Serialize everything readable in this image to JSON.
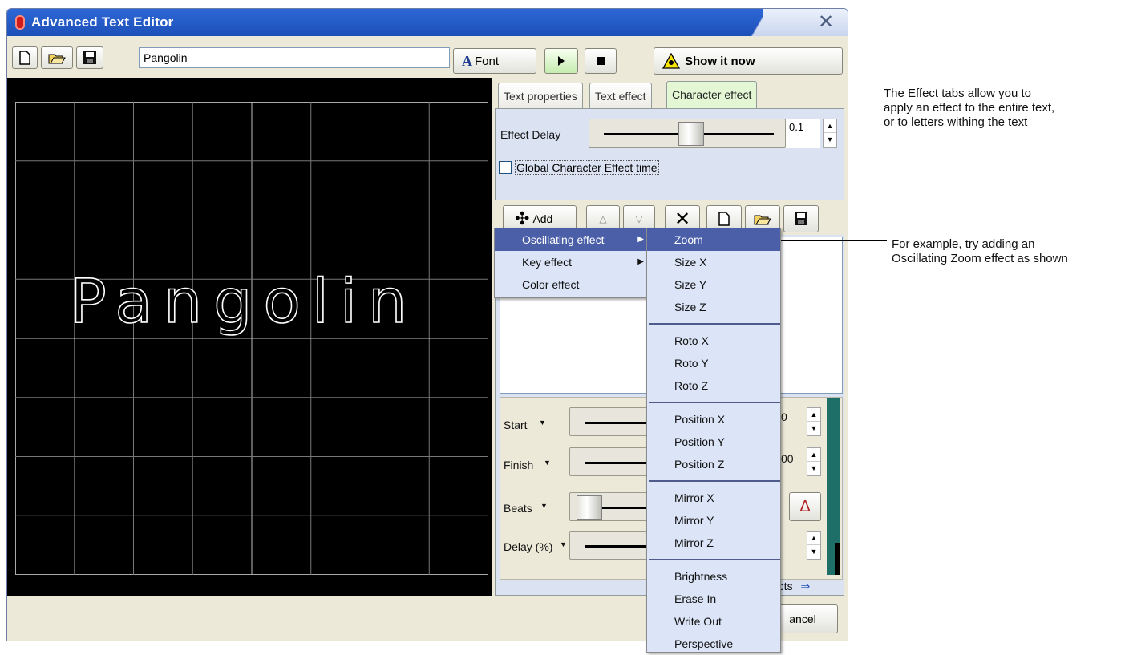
{
  "window": {
    "title": "Advanced Text Editor",
    "close_glyph": "✕"
  },
  "toolbar": {
    "text_value": "Pangolin",
    "font_label": "Font",
    "font_icon_letter": "A",
    "show_label": "Show it now"
  },
  "preview": {
    "text": "Pangolin"
  },
  "tabs": [
    {
      "label": "Text properties"
    },
    {
      "label": "Text effect"
    },
    {
      "label": "Character effect"
    }
  ],
  "char_effect": {
    "effect_delay_label": "Effect Delay",
    "effect_delay_value": "0.1",
    "global_checkbox_label": "Global Character Effect time",
    "global_checked": false,
    "add_label": "Add",
    "effect_delay_slider_fraction": 0.5
  },
  "params": [
    {
      "label": "Start",
      "value": "0"
    },
    {
      "label": "Finish",
      "value": "00"
    },
    {
      "label": "Beats",
      "value": ""
    },
    {
      "label": "Delay (%)",
      "value": ""
    }
  ],
  "effects_link": "fects",
  "cancel_label": "ancel",
  "menu_main": [
    {
      "label": "Oscillating effect",
      "submenu": true,
      "highlighted": true
    },
    {
      "label": "Key effect",
      "submenu": true,
      "highlighted": false
    },
    {
      "label": "Color effect",
      "submenu": false,
      "highlighted": false
    }
  ],
  "menu_sub": [
    {
      "label": "Zoom",
      "highlighted": true
    },
    {
      "label": "Size X"
    },
    {
      "label": "Size Y"
    },
    {
      "label": "Size Z"
    },
    {
      "sep": true
    },
    {
      "label": "Roto X"
    },
    {
      "label": "Roto Y"
    },
    {
      "label": "Roto Z"
    },
    {
      "sep": true
    },
    {
      "label": "Position X"
    },
    {
      "label": "Position Y"
    },
    {
      "label": "Position Z"
    },
    {
      "sep": true
    },
    {
      "label": "Mirror X"
    },
    {
      "label": "Mirror Y"
    },
    {
      "label": "Mirror Z"
    },
    {
      "sep": true
    },
    {
      "label": "Brightness"
    },
    {
      "label": "Erase In"
    },
    {
      "label": "Write Out"
    },
    {
      "label": "Perspective"
    }
  ],
  "annotations": {
    "tabs_note": [
      "The Effect tabs allow you to",
      "apply an effect to the entire text,",
      "or to letters withing the text"
    ],
    "example_note": [
      "For example, try adding an",
      "Oscillating Zoom effect as shown"
    ]
  },
  "colors": {
    "title_bar": "#2d68d6",
    "highlight": "#4b5fa8",
    "active_tab": "#e3f7d4",
    "preview_bg": "#000000"
  }
}
